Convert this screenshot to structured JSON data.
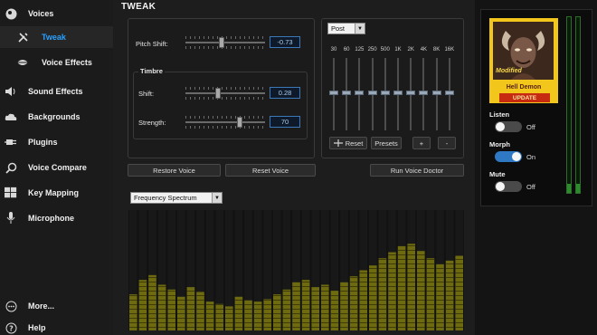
{
  "sidebar": {
    "items": [
      {
        "label": "Voices",
        "icon": "voices-icon"
      },
      {
        "label": "Tweak",
        "icon": "tools-icon"
      },
      {
        "label": "Voice Effects",
        "icon": "lips-icon"
      },
      {
        "label": "Sound Effects",
        "icon": "speaker-icon"
      },
      {
        "label": "Backgrounds",
        "icon": "cloud-icon"
      },
      {
        "label": "Plugins",
        "icon": "plug-icon"
      },
      {
        "label": "Voice Compare",
        "icon": "magnifier-icon"
      },
      {
        "label": "Key Mapping",
        "icon": "keyboard-icon"
      },
      {
        "label": "Microphone",
        "icon": "microphone-icon"
      },
      {
        "label": "More...",
        "icon": "more-icon"
      },
      {
        "label": "Help",
        "icon": "help-icon"
      }
    ]
  },
  "main": {
    "title": "TWEAK",
    "pitch": {
      "label": "Pitch Shift:",
      "value": "-0.73",
      "level": 0.45
    },
    "timbre": {
      "group_label": "Timbre",
      "shift": {
        "label": "Shift:",
        "value": "0.28",
        "level": 0.4
      },
      "strength": {
        "label": "Strength:",
        "value": "70",
        "level": 0.7
      }
    },
    "buttons": {
      "restore": "Restore Voice",
      "reset": "Reset Voice",
      "doctor": "Run Voice Doctor"
    },
    "eq": {
      "mode": "Post",
      "bands": [
        "30",
        "60",
        "125",
        "250",
        "500",
        "1K",
        "2K",
        "4K",
        "8K",
        "16K"
      ],
      "reset": "Reset",
      "presets": "Presets",
      "plus": "+",
      "minus": "-"
    },
    "spectrum": {
      "mode": "Frequency Spectrum",
      "bars": [
        0.3,
        0.42,
        0.46,
        0.38,
        0.34,
        0.28,
        0.36,
        0.32,
        0.24,
        0.22,
        0.2,
        0.28,
        0.25,
        0.24,
        0.26,
        0.3,
        0.34,
        0.4,
        0.42,
        0.36,
        0.38,
        0.33,
        0.4,
        0.45,
        0.5,
        0.54,
        0.6,
        0.65,
        0.7,
        0.72,
        0.66,
        0.6,
        0.55,
        0.58,
        0.62
      ]
    }
  },
  "voice": {
    "name": "Hell Demon",
    "badge": "Modified",
    "update": "UPDATE",
    "listen": {
      "label": "Listen",
      "state": "Off"
    },
    "morph": {
      "label": "Morph",
      "state": "On"
    },
    "mute": {
      "label": "Mute",
      "state": "Off"
    }
  },
  "colors": {
    "accent": "#2aa1ff",
    "avatar_frame": "#f3c61b",
    "update": "#c62b12",
    "spectrum": "#6e6a10"
  }
}
